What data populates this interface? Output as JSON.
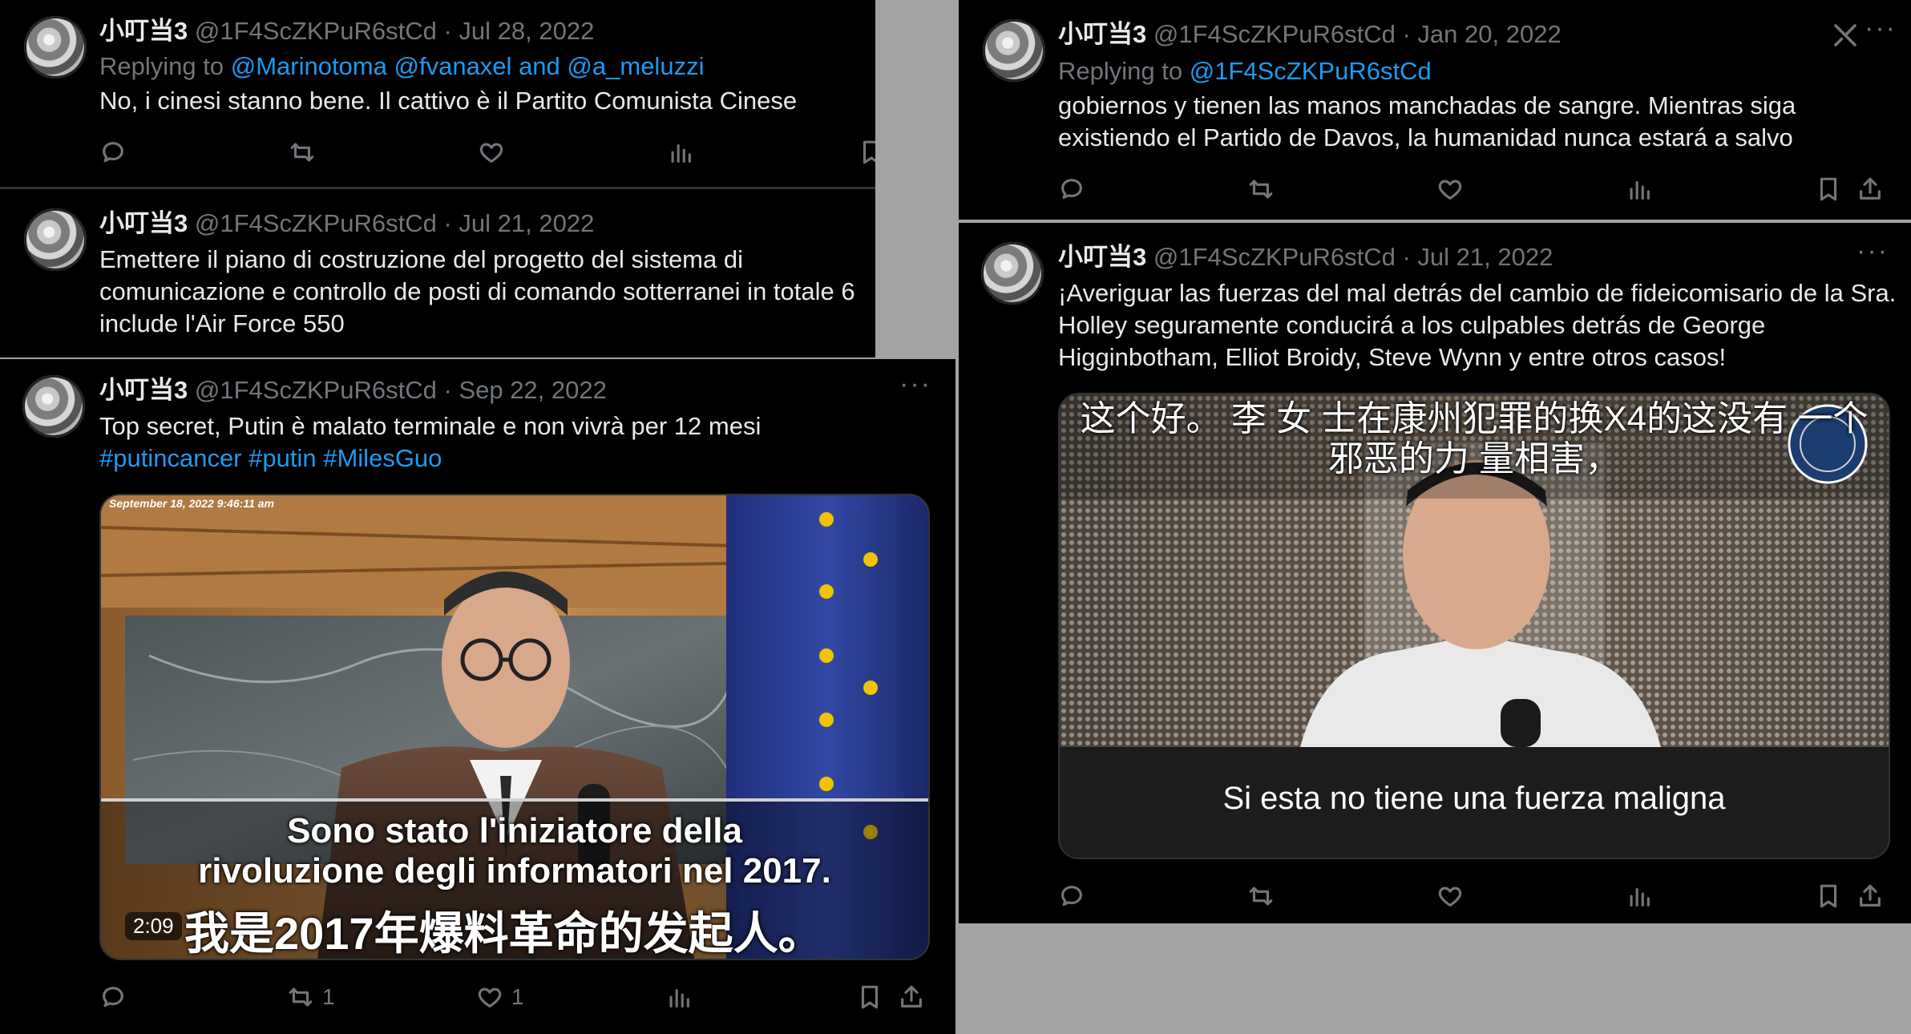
{
  "colors": {
    "link": "#1d9bf0",
    "muted": "#71767b",
    "text": "#e7e9ea",
    "panel": "#000000",
    "backdrop": "#a3a3a3"
  },
  "user": {
    "name": "小叮当3",
    "handle": "@1F4ScZKPuR6stCd"
  },
  "left": {
    "tweet1": {
      "date": "Jul 28, 2022",
      "replying_prefix": "Replying to",
      "mention1": "@Marinotoma",
      "mention2": "@fvanaxel",
      "and": "and",
      "mention3": "@a_meluzzi",
      "text": "No, i cinesi stanno bene. Il cattivo è il Partito Comunista Cinese"
    },
    "tweet2": {
      "date": "Jul 21, 2022",
      "lines": [
        "Emettere il piano di costruzione del progetto del sistema di",
        "comunicazione e controllo de posti di comando sotterranei in totale 6",
        "include l'Air Force 550"
      ]
    },
    "tweet3": {
      "date": "Sep 22, 2022",
      "text": "Top secret, Putin è malato terminale e non vivrà per 12 mesi",
      "hashtags": [
        "#putincancer",
        "#putin",
        "#MilesGuo"
      ],
      "video": {
        "timestamp": "September 18, 2022 9:46:11 am",
        "subtitle_it_1": "Sono stato l'iniziatore della",
        "subtitle_it_2": "rivoluzione degli informatori nel 2017.",
        "subtitle_cn": "我是2017年爆料革命的发起人。",
        "duration": "2:09"
      },
      "retweets": "1",
      "likes": "1"
    }
  },
  "right": {
    "tweet1": {
      "date": "Jan 20, 2022",
      "replying_prefix": "Replying to",
      "mention": "@1F4ScZKPuR6stCd",
      "lines": [
        "gobiernos y tienen las manos manchadas de sangre. Mientras siga",
        "existiendo el Partido de Davos, la humanidad nunca estará a salvo"
      ]
    },
    "tweet2": {
      "date": "Jul 21, 2022",
      "lines": [
        "¡Averiguar las fuerzas del mal detrás del cambio de fideicomisario de la Sra.",
        "Holley seguramente conducirá a los culpables detrás de George",
        "Higginbotham, Elliot Broidy, Steve Wynn y entre otros casos!"
      ],
      "video": {
        "subtitle_cn_1": "这个好。 李 女 士在康州犯罪的换X4的这没有 一个",
        "subtitle_cn_2": "邪恶的力 量相害，",
        "caption_es": "Si esta no tiene una fuerza maligna"
      }
    }
  },
  "meta": {
    "separator": "·",
    "more": "···"
  }
}
